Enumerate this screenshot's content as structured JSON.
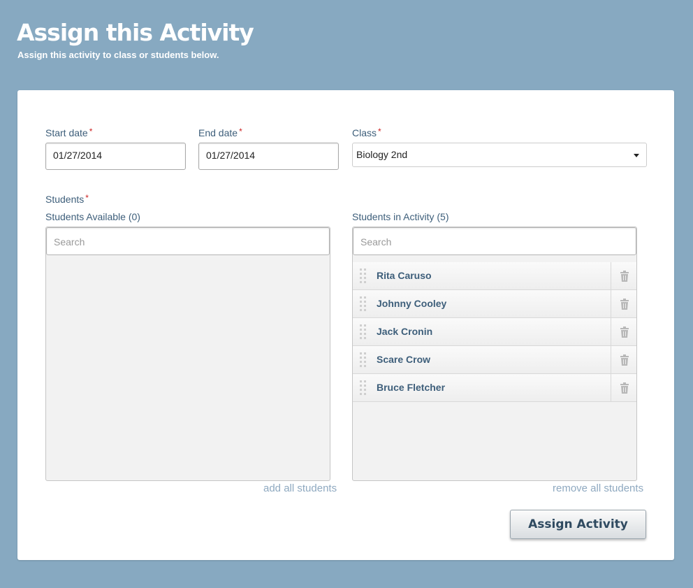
{
  "header": {
    "title": "Assign this Activity",
    "subtitle": "Assign this activity to class or students below."
  },
  "form": {
    "start_date": {
      "label": "Start date",
      "value": "01/27/2014"
    },
    "end_date": {
      "label": "End date",
      "value": "01/27/2014"
    },
    "class": {
      "label": "Class",
      "selected": "Biology 2nd"
    },
    "required_marker": "*",
    "students_label": "Students"
  },
  "available": {
    "title": "Students Available (0)",
    "search_placeholder": "Search",
    "action": "add all students"
  },
  "in_activity": {
    "title": "Students in Activity (5)",
    "search_placeholder": "Search",
    "action": "remove all students",
    "students": [
      "Rita Caruso",
      "Johnny Cooley",
      "Jack Cronin",
      "Scare Crow",
      "Bruce Fletcher"
    ]
  },
  "buttons": {
    "assign": "Assign Activity"
  },
  "icons": {
    "drag": "drag-handle-icon",
    "delete": "trash-icon",
    "dropdown": "caret-down-icon"
  },
  "colors": {
    "background": "#87a9c1",
    "label": "#3d5e7a",
    "required": "#cc2222",
    "link": "#8fa9c0"
  }
}
